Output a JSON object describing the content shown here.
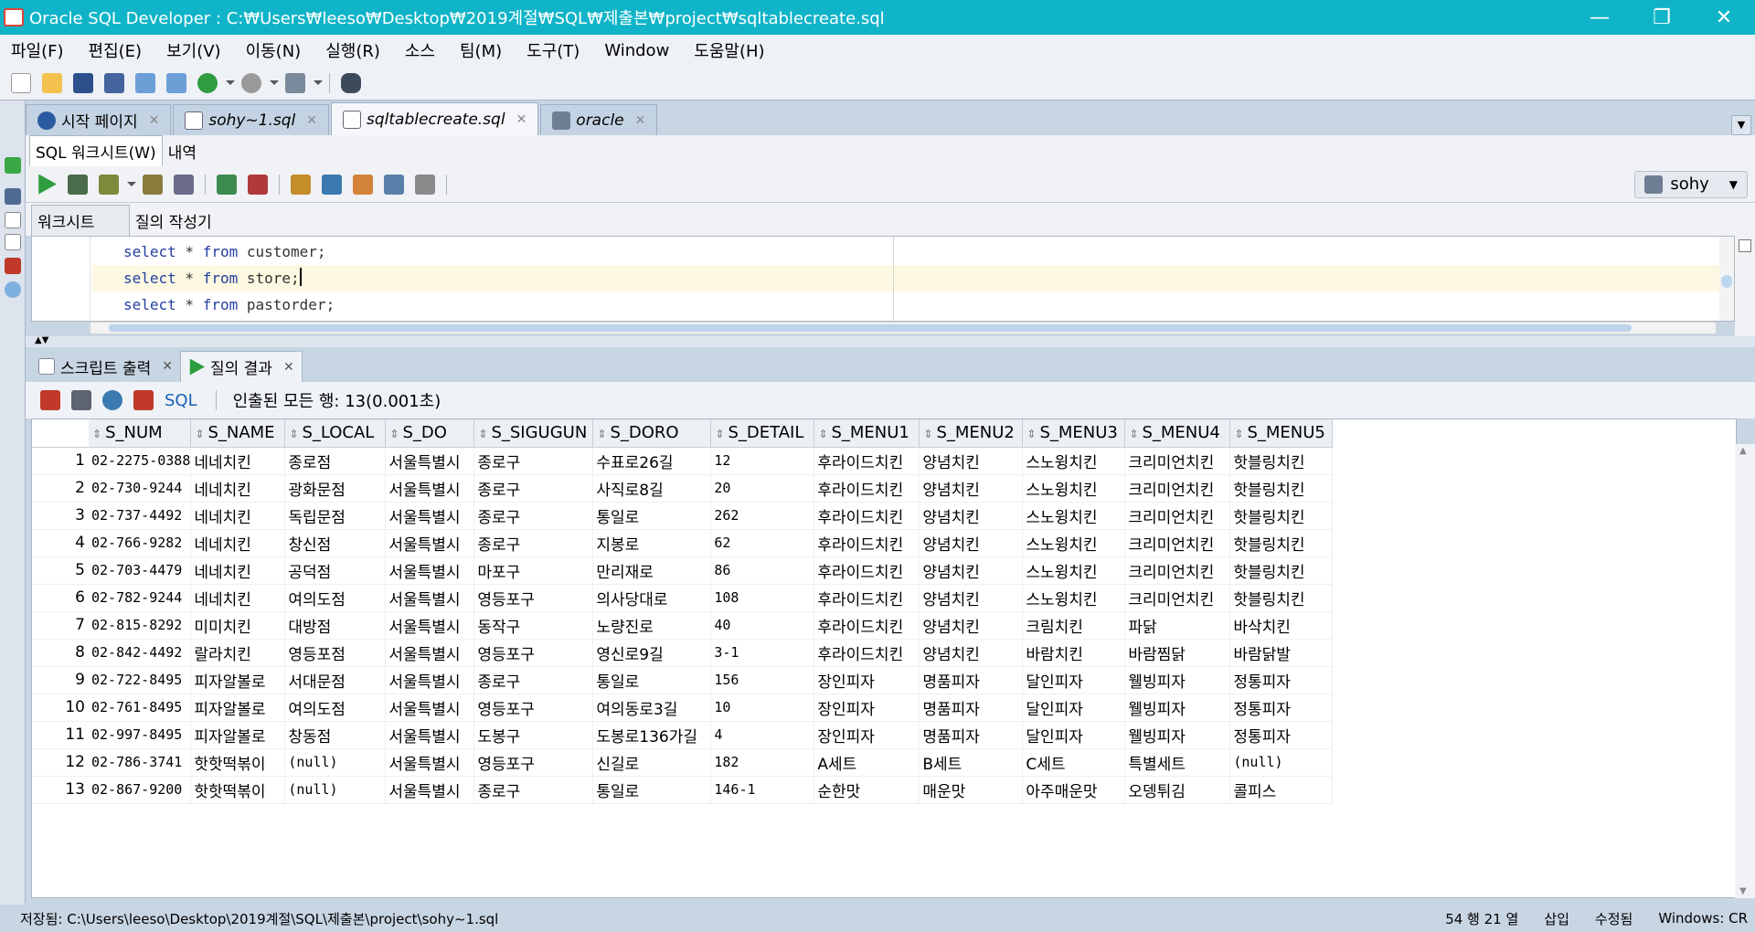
{
  "window": {
    "title": "Oracle SQL Developer : C:₩Users₩leeso₩Desktop₩2019계절₩SQL₩제출본₩project₩sqltablecreate.sql",
    "min": "—",
    "restore": "❐",
    "close": "✕"
  },
  "menu": [
    "파일(F)",
    "편집(E)",
    "보기(V)",
    "이동(N)",
    "실행(R)",
    "소스",
    "팀(M)",
    "도구(T)",
    "Window",
    "도움말(H)"
  ],
  "doc_tabs": [
    {
      "label": "시작 페이지",
      "icon": "help-icon",
      "italic": false
    },
    {
      "label": "sohy~1.sql",
      "icon": "sql-file-icon",
      "italic": true
    },
    {
      "label": "sqltablecreate.sql",
      "icon": "sql-file-icon",
      "italic": true,
      "active": true
    },
    {
      "label": "oracle",
      "icon": "database-icon",
      "italic": true
    }
  ],
  "sub_tabs": [
    "SQL 워크시트(W)",
    "내역"
  ],
  "connection": "sohy",
  "worksheet_tabs": [
    "워크시트",
    "질의 작성기"
  ],
  "editor": {
    "lines": [
      {
        "kw1": "select",
        "mid": " * ",
        "kw2": "from",
        "tail": " customer;"
      },
      {
        "kw1": "select",
        "mid": " * ",
        "kw2": "from",
        "tail": " store;"
      },
      {
        "kw1": "select",
        "mid": " * ",
        "kw2": "from",
        "tail": " pastorder;"
      }
    ]
  },
  "result_tabs": [
    "스크립트 출력",
    "질의 결과"
  ],
  "results_toolbar": {
    "sql_label": "SQL",
    "fetch_text": "인출된 모든 행: 13(0.001초)"
  },
  "grid": {
    "columns": [
      "S_NUM",
      "S_NAME",
      "S_LOCAL",
      "S_DO",
      "S_SIGUGUN",
      "S_DORO",
      "S_DETAIL",
      "S_MENU1",
      "S_MENU2",
      "S_MENU3",
      "S_MENU4",
      "S_MENU5"
    ],
    "rows": [
      [
        "1",
        "02-2275-0388",
        "네네치킨",
        "종로점",
        "서울특별시",
        "종로구",
        "수표로26길",
        "12",
        "후라이드치킨",
        "양념치킨",
        "스노윙치킨",
        "크리미언치킨",
        "핫블링치킨"
      ],
      [
        "2",
        "02-730-9244",
        "네네치킨",
        "광화문점",
        "서울특별시",
        "종로구",
        "사직로8길",
        "20",
        "후라이드치킨",
        "양념치킨",
        "스노윙치킨",
        "크리미언치킨",
        "핫블링치킨"
      ],
      [
        "3",
        "02-737-4492",
        "네네치킨",
        "독립문점",
        "서울특별시",
        "종로구",
        "통일로",
        "262",
        "후라이드치킨",
        "양념치킨",
        "스노윙치킨",
        "크리미언치킨",
        "핫블링치킨"
      ],
      [
        "4",
        "02-766-9282",
        "네네치킨",
        "창신점",
        "서울특별시",
        "종로구",
        "지봉로",
        "62",
        "후라이드치킨",
        "양념치킨",
        "스노윙치킨",
        "크리미언치킨",
        "핫블링치킨"
      ],
      [
        "5",
        "02-703-4479",
        "네네치킨",
        "공덕점",
        "서울특별시",
        "마포구",
        "만리재로",
        "86",
        "후라이드치킨",
        "양념치킨",
        "스노윙치킨",
        "크리미언치킨",
        "핫블링치킨"
      ],
      [
        "6",
        "02-782-9244",
        "네네치킨",
        "여의도점",
        "서울특별시",
        "영등포구",
        "의사당대로",
        "108",
        "후라이드치킨",
        "양념치킨",
        "스노윙치킨",
        "크리미언치킨",
        "핫블링치킨"
      ],
      [
        "7",
        "02-815-8292",
        "미미치킨",
        "대방점",
        "서울특별시",
        "동작구",
        "노량진로",
        "40",
        "후라이드치킨",
        "양념치킨",
        "크림치킨",
        "파닭",
        "바삭치킨"
      ],
      [
        "8",
        "02-842-4492",
        "랄라치킨",
        "영등포점",
        "서울특별시",
        "영등포구",
        "영신로9길",
        "3-1",
        "후라이드치킨",
        "양념치킨",
        "바람치킨",
        "바람찜닭",
        "바람닭발"
      ],
      [
        "9",
        "02-722-8495",
        "피자알볼로",
        "서대문점",
        "서울특별시",
        "종로구",
        "통일로",
        "156",
        "장인피자",
        "명품피자",
        "달인피자",
        "웰빙피자",
        "정통피자"
      ],
      [
        "10",
        "02-761-8495",
        "피자알볼로",
        "여의도점",
        "서울특별시",
        "영등포구",
        "여의동로3길",
        "10",
        "장인피자",
        "명품피자",
        "달인피자",
        "웰빙피자",
        "정통피자"
      ],
      [
        "11",
        "02-997-8495",
        "피자알볼로",
        "창동점",
        "서울특별시",
        "도봉구",
        "도봉로136가길",
        "4",
        "장인피자",
        "명품피자",
        "달인피자",
        "웰빙피자",
        "정통피자"
      ],
      [
        "12",
        "02-786-3741",
        "핫핫떡볶이",
        "(null)",
        "서울특별시",
        "영등포구",
        "신길로",
        "182",
        "A세트",
        "B세트",
        "C세트",
        "특별세트",
        "(null)"
      ],
      [
        "13",
        "02-867-9200",
        "핫핫떡볶이",
        "(null)",
        "서울특별시",
        "종로구",
        "통일로",
        "146-1",
        "순한맛",
        "매운맛",
        "아주매운맛",
        "오뎅튀김",
        "콜피스"
      ]
    ]
  },
  "status": {
    "saved": "저장됨: C:\\Users\\leeso\\Desktop\\2019계절\\SQL\\제출본\\project\\sohy~1.sql",
    "position": "54 행 21 열",
    "mode": "삽입",
    "modified": "수정됨",
    "os": "Windows: CR"
  },
  "colors": {
    "titlebar": "#10b4c8",
    "tab_bar": "#c8d5e3",
    "current_line": "#fdf8e2",
    "keyword": "#2340a0"
  }
}
